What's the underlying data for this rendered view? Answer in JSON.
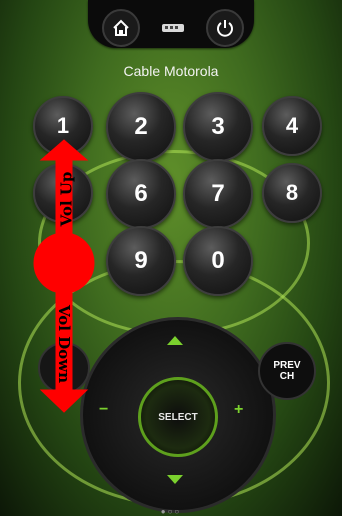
{
  "topbar": {
    "home_icon": "home-icon",
    "remote_icon": "remote-icon",
    "power_icon": "power-icon"
  },
  "device": {
    "title": "Cable Motorola"
  },
  "keypad": {
    "keys": [
      "1",
      "2",
      "3",
      "4",
      "5",
      "6",
      "7",
      "8",
      "9",
      "0"
    ]
  },
  "controls": {
    "select_label": "SELECT",
    "prev_label_line1": "PREV",
    "prev_label_line2": "CH",
    "up_icon": "chevron-up-icon",
    "down_icon": "chevron-down-icon",
    "minus_label": "−",
    "plus_label": "+",
    "page_dots": "●○○"
  },
  "overlay": {
    "vol_up_label": "Vol Up",
    "vol_down_label": "Vol Down",
    "color": "#ff0000"
  }
}
